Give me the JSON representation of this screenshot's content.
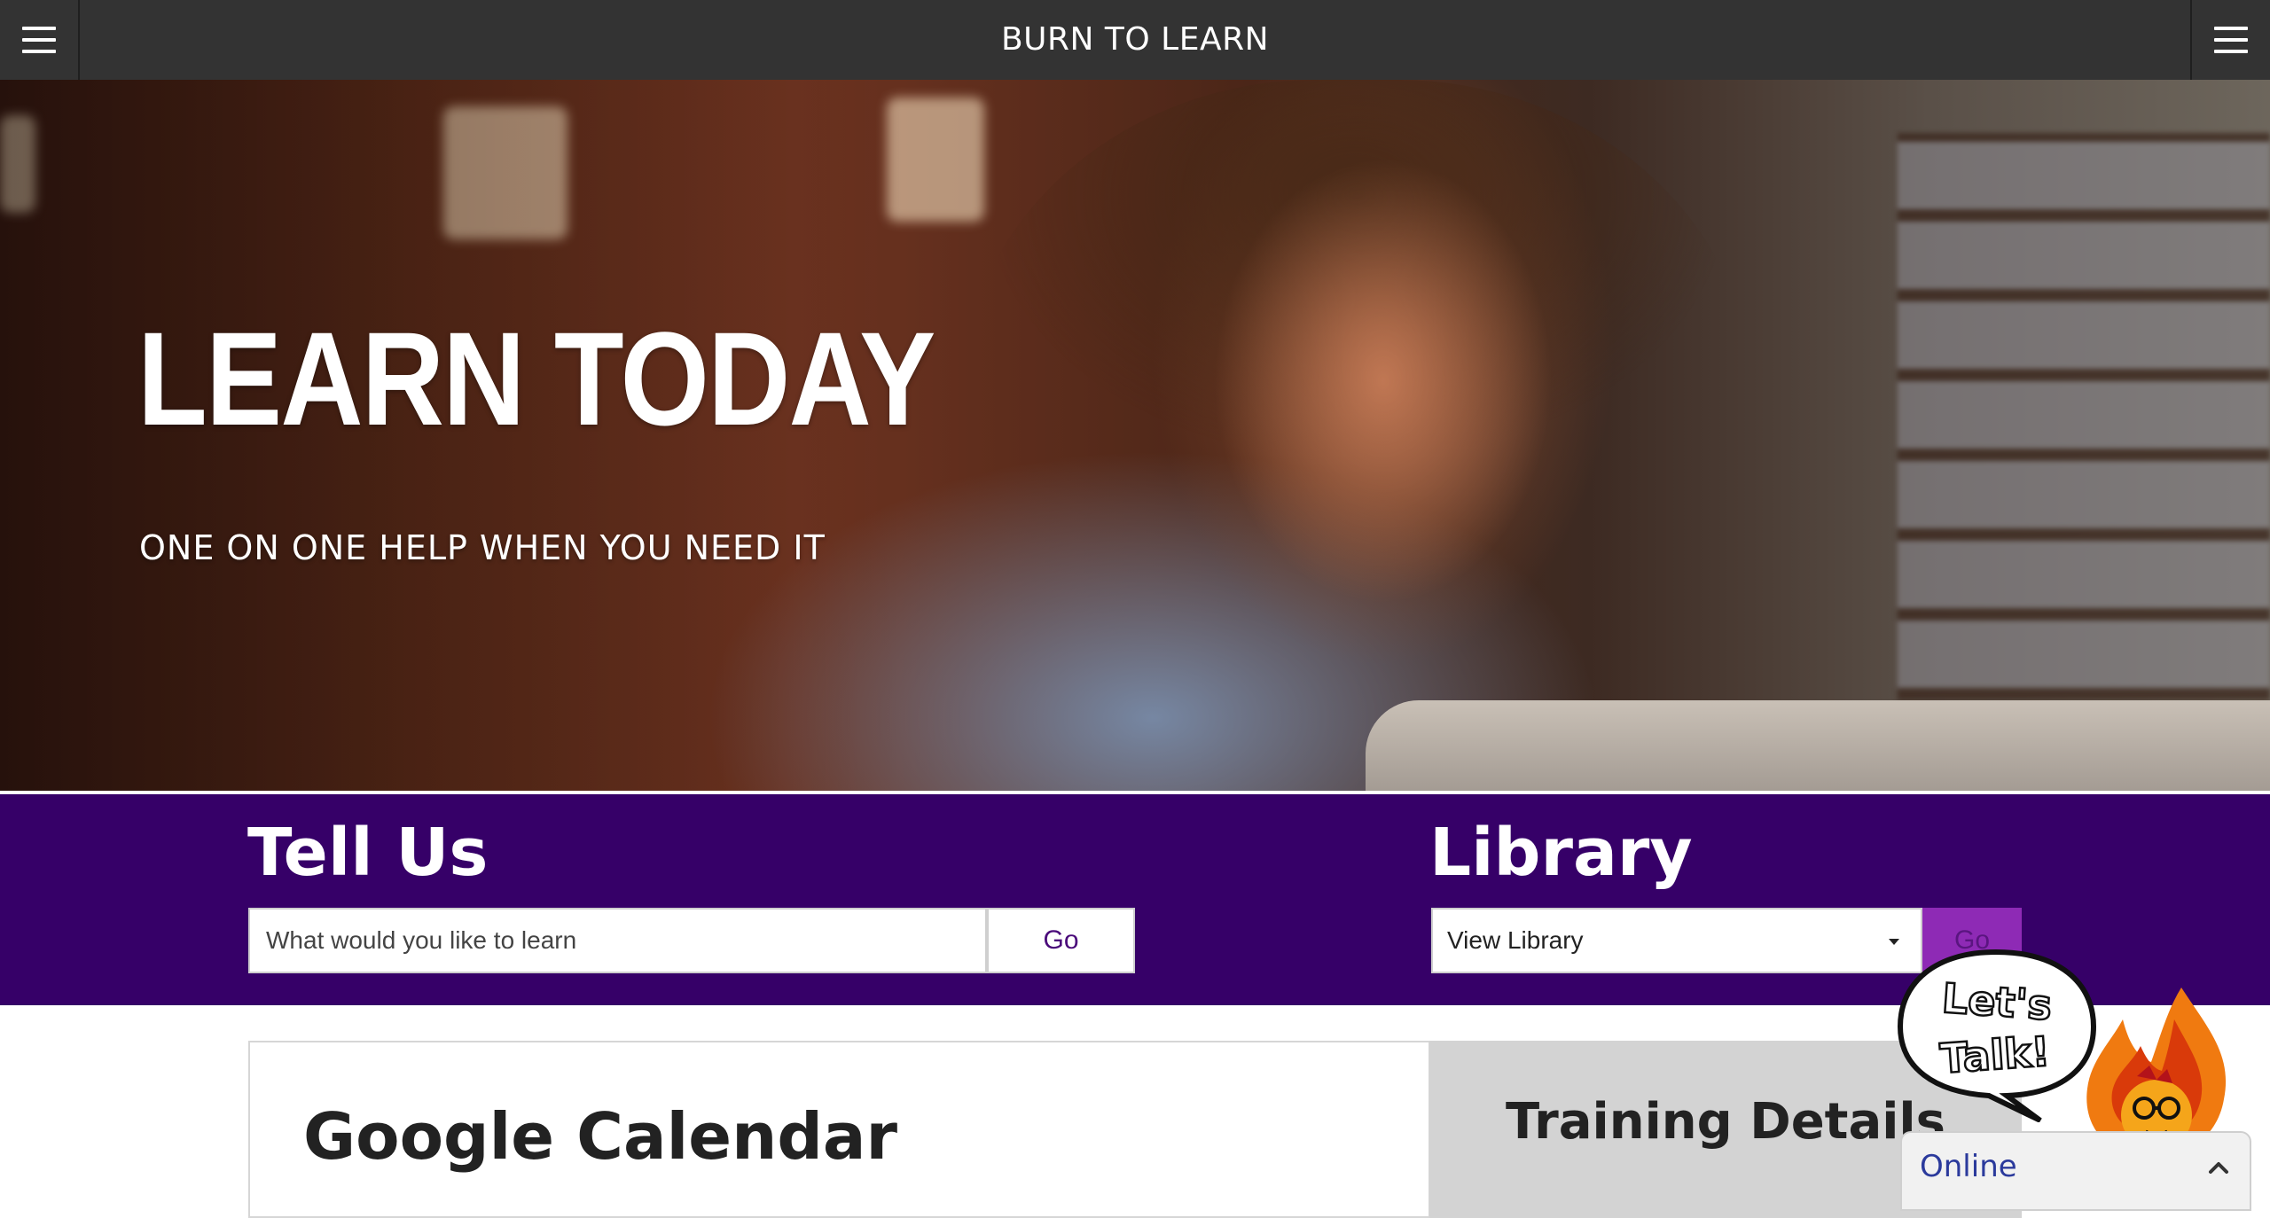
{
  "header": {
    "title": "BURN TO LEARN",
    "left_menu_icon": "hamburger-menu-icon",
    "right_menu_icon": "hamburger-menu-icon"
  },
  "hero": {
    "headline": "LEARN TODAY",
    "subheadline": "ONE ON ONE HELP WHEN YOU NEED IT"
  },
  "tell_us": {
    "heading": "Tell Us",
    "input_value": "",
    "input_placeholder": "What would you like to learn",
    "go_label": "Go"
  },
  "library": {
    "heading": "Library",
    "selected_option": "View Library",
    "go_label": "Go"
  },
  "content": {
    "calendar_title": "Google Calendar",
    "training_title": "Training Details"
  },
  "chat": {
    "bubble_text": "Let's Talk!",
    "status": "Online",
    "toggle_icon": "chevron-up-icon",
    "mascot_icon": "flame-mascot-icon"
  },
  "colors": {
    "topbar": "#333333",
    "band": "#360068",
    "library_go": "#8e2ab5",
    "go_text": "#4a0a7a",
    "chat_status": "#2b3a9c"
  }
}
